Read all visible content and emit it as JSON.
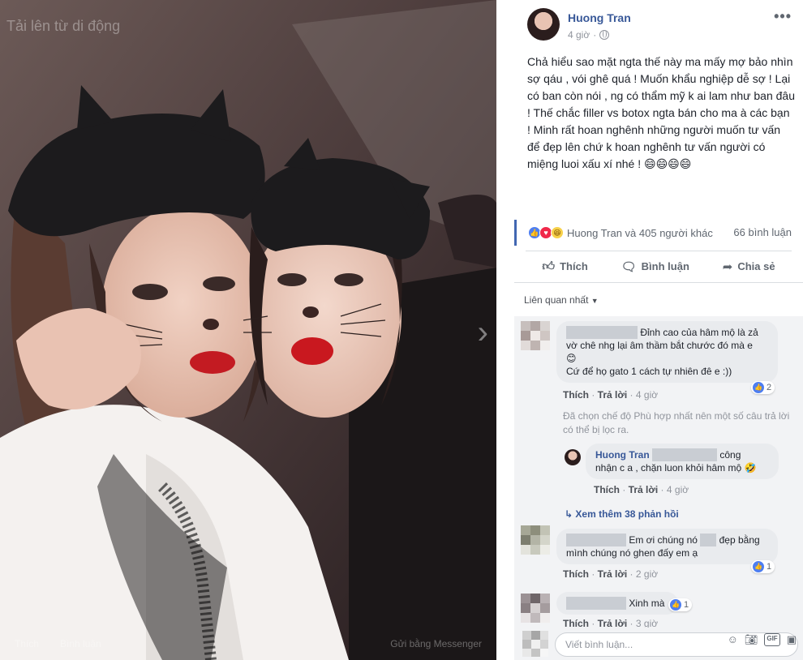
{
  "photo": {
    "upload_hint": "Tải lên từ di động",
    "next_arrow": "›",
    "actions": [
      "Thích",
      "Bình luận"
    ],
    "action_right": "Gửi bằng Messenger"
  },
  "post": {
    "author": "Huong Tran",
    "time": "4 giờ",
    "more_icon": "•••",
    "text": "Chả hiểu sao mặt ngta thế này ma mấy mợ bảo nhìn sợ qáu , vói ghê quá ! Muốn khẩu nghiệp dễ sợ ! Lại có ban còn nói , ng có thẩm mỹ k ai lam như ban đâu ! Thế chắc filler vs botox ngta bán cho ma à các bạn ! Minh rất hoan nghênh những người muốn tư vấn để đẹp lên chứ k hoan nghênh tư vấn người có miệng luoi xấu xí nhé ! 😄😄😄😄"
  },
  "reactions": {
    "icons": [
      "like-icon",
      "love-icon",
      "haha-icon"
    ],
    "names": "Huong Tran và 405 người khác",
    "comment_count": "66 bình luận"
  },
  "actions": {
    "like": "Thích",
    "comment": "Bình luận",
    "share": "Chia sẻ"
  },
  "sort": {
    "label": "Liên quan nhất",
    "caret": "▼"
  },
  "comments": [
    {
      "text1": "Đỉnh cao của hâm mộ là zả",
      "text2": "vờ chê nhg lại âm thầm bắt chước đó mà e",
      "emoji": "😊",
      "text3": "Cứ để họ gato 1 cách tự nhiên đê e :))",
      "likes": "2",
      "like": "Thích",
      "reply": "Trả lời",
      "time": "4 giờ"
    },
    {
      "text1": "Em ơi chúng nó",
      "text1b": "đẹp bằng",
      "text2": "mình chúng nó ghen đấy em ạ",
      "likes": "1",
      "like": "Thích",
      "reply": "Trả lời",
      "time": "2 giờ"
    },
    {
      "text1": "Xinh mà",
      "likes": "1",
      "like": "Thích",
      "reply": "Trả lời",
      "time": "3 giờ"
    }
  ],
  "filter_note": "Đã chọn chế độ Phù hợp nhất nên một số câu trả lời có thể bị lọc ra.",
  "reply": {
    "author": "Huong Tran",
    "text1": "công",
    "text2": "nhận c a , chặn luon khỏi hâm mộ",
    "emoji": "🤣",
    "like": "Thích",
    "reply": "Trả lời",
    "time": "4 giờ"
  },
  "more_replies": "Xem thêm 38 phản hồi",
  "more_replies_icon": "↳",
  "compose": {
    "placeholder": "Viết bình luận...",
    "icons": [
      "emoji-icon",
      "camera-icon",
      "gif-icon",
      "sticker-icon"
    ],
    "gif_label": "GIF"
  },
  "colors": {
    "link": "#385898",
    "accent": "#4267b2",
    "comment_bg": "#f2f3f5",
    "bubble_bg": "#e9ebee"
  }
}
